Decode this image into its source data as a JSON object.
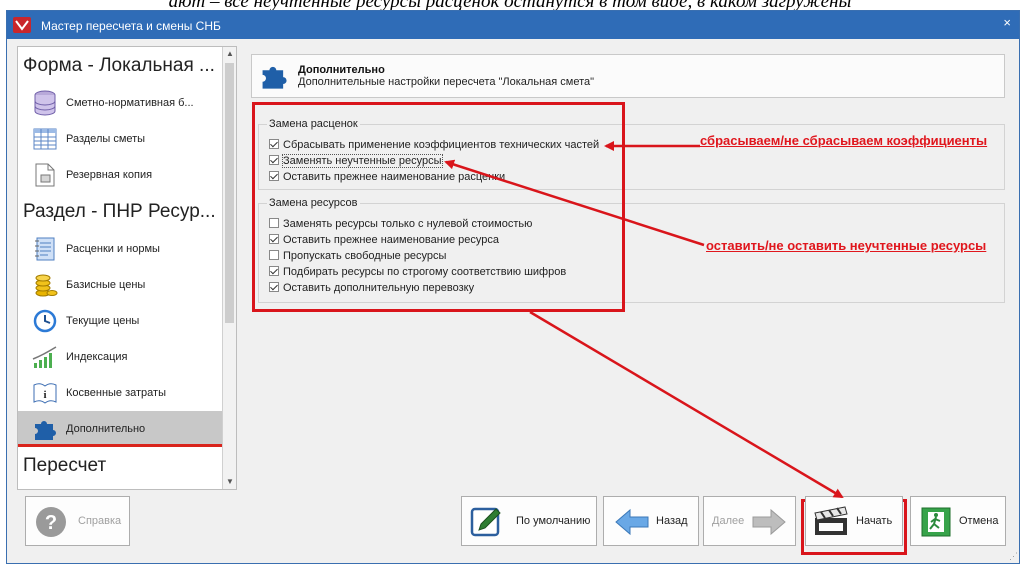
{
  "background_caption": "ают – все неучтенные ресурсы расценок останутся в том виде, в каком загружены",
  "window": {
    "title": "Мастер пересчета и смены СНБ",
    "close_glyph": "×"
  },
  "nav": {
    "groups": [
      {
        "header": "Форма - Локальная ...",
        "items": [
          {
            "label": "Сметно-нормативная б...",
            "icon": "database-icon"
          },
          {
            "label": "Разделы сметы",
            "icon": "table-icon"
          },
          {
            "label": "Резервная копия",
            "icon": "backup-file-icon"
          }
        ]
      },
      {
        "header": "Раздел - ПНР Ресур...",
        "items": [
          {
            "label": "Расценки и нормы",
            "icon": "notebook-icon"
          },
          {
            "label": "Базисные цены",
            "icon": "coins-icon"
          },
          {
            "label": "Текущие цены",
            "icon": "clock-icon"
          },
          {
            "label": "Индексация",
            "icon": "growth-chart-icon"
          },
          {
            "label": "Косвенные затраты",
            "icon": "info-book-icon"
          },
          {
            "label": "Дополнительно",
            "icon": "puzzle-icon",
            "selected": true
          }
        ]
      },
      {
        "header": "Пересчет",
        "items": []
      }
    ]
  },
  "header": {
    "title": "Дополнительно",
    "subtitle": "Дополнительные настройки пересчета \"Локальная смета\"",
    "icon": "puzzle-icon"
  },
  "pricing_group": {
    "title": "Замена расценок",
    "options": [
      {
        "label": "Сбрасывать применение коэффициентов технических частей",
        "checked": true
      },
      {
        "label": "Заменять неучтенные ресурсы",
        "checked": true,
        "focused": true
      },
      {
        "label": "Оставить прежнее наименование расценки",
        "checked": true
      }
    ]
  },
  "resources_group": {
    "title": "Замена ресурсов",
    "options": [
      {
        "label": "Заменять ресурсы только с нулевой стоимостью",
        "checked": false
      },
      {
        "label": "Оставить прежнее наименование ресурса",
        "checked": true
      },
      {
        "label": "Пропускать свободные ресурсы",
        "checked": false
      },
      {
        "label": "Подбирать ресурсы по строгому соответствию шифров",
        "checked": true
      },
      {
        "label": "Оставить дополнительную перевозку",
        "checked": true
      }
    ]
  },
  "annotations": {
    "coefficients": "сбрасываем/не сбрасываем коэффициенты",
    "unaccounted": "оставить/не оставить неучтенные ресурсы"
  },
  "buttons": {
    "help": {
      "label": "Справка",
      "icon": "help-icon",
      "disabled": true
    },
    "defaults": {
      "label": "По умолчанию",
      "icon": "edit-pencil-icon"
    },
    "back": {
      "label": "Назад",
      "icon": "arrow-left-icon"
    },
    "next": {
      "label": "Далее",
      "icon": "arrow-right-icon",
      "disabled": true
    },
    "start": {
      "label": "Начать",
      "icon": "clapperboard-icon"
    },
    "cancel": {
      "label": "Отмена",
      "icon": "exit-icon"
    }
  },
  "colors": {
    "titlebar": "#2f6cb7",
    "highlight_red": "#d9151b",
    "selection": "#c8c8c8"
  }
}
